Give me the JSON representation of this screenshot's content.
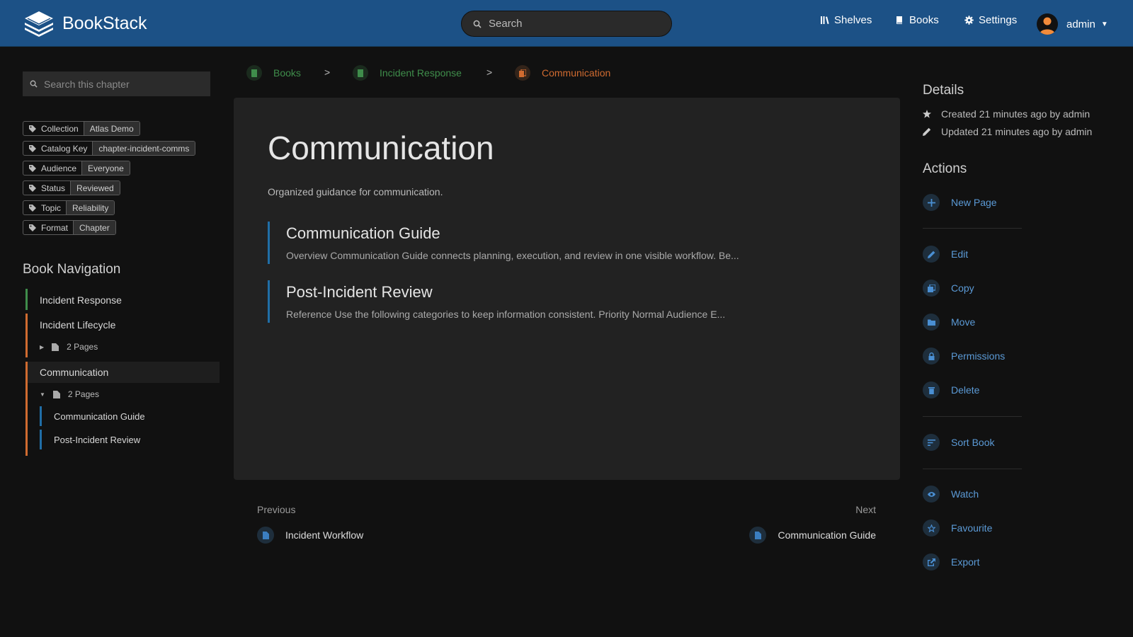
{
  "header": {
    "app_name": "BookStack",
    "search_placeholder": "Search",
    "nav": {
      "shelves": "Shelves",
      "books": "Books",
      "settings": "Settings"
    },
    "user": "admin"
  },
  "sidebar": {
    "search_placeholder": "Search this chapter",
    "tags": [
      {
        "name": "Collection",
        "value": "Atlas Demo"
      },
      {
        "name": "Catalog Key",
        "value": "chapter-incident-comms"
      },
      {
        "name": "Audience",
        "value": "Everyone"
      },
      {
        "name": "Status",
        "value": "Reviewed"
      },
      {
        "name": "Topic",
        "value": "Reliability"
      },
      {
        "name": "Format",
        "value": "Chapter"
      }
    ],
    "book_nav_title": "Book Navigation",
    "book": "Incident Response",
    "chapters": [
      {
        "name": "Incident Lifecycle",
        "pages": "2 Pages"
      },
      {
        "name": "Communication",
        "pages": "2 Pages",
        "children": [
          "Communication Guide",
          "Post-Incident Review"
        ]
      }
    ]
  },
  "breadcrumb": [
    "Books",
    "Incident Response",
    "Communication"
  ],
  "main": {
    "title": "Communication",
    "description": "Organized guidance for communication.",
    "entries": [
      {
        "title": "Communication Guide",
        "excerpt": "Overview Communication Guide connects planning, execution, and review in one visible workflow. Be..."
      },
      {
        "title": "Post-Incident Review",
        "excerpt": "Reference Use the following categories to keep information consistent. Priority Normal Audience E..."
      }
    ]
  },
  "pager": {
    "previous_label": "Previous",
    "previous_page": "Incident Workflow",
    "next_label": "Next",
    "next_page": "Communication Guide"
  },
  "details": {
    "title": "Details",
    "created": "Created 21 minutes ago by admin",
    "updated": "Updated 21 minutes ago by admin"
  },
  "actions": {
    "title": "Actions",
    "new_page": "New Page",
    "edit": "Edit",
    "copy": "Copy",
    "move": "Move",
    "permissions": "Permissions",
    "delete": "Delete",
    "sort_book": "Sort Book",
    "watch": "Watch",
    "favourite": "Favourite",
    "export": "Export"
  },
  "colors": {
    "header": "#1c5186",
    "book": "#3f8d4b",
    "chapter": "#d06b30",
    "page": "#206ea7",
    "link": "#5b9ad6"
  }
}
